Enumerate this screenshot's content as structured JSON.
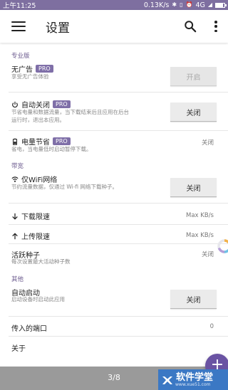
{
  "status_bar": {
    "time": "上午11:25",
    "speed": "0.13K/s",
    "network": "4G",
    "battery_level": 0.8,
    "icons": [
      "notification-icon",
      "bluetooth-icon",
      "vibrate-icon",
      "alarm-icon",
      "signal-icon",
      "battery-icon"
    ]
  },
  "appbar": {
    "title": "设置"
  },
  "sections": {
    "pro": "专业版",
    "torrents": "带宽",
    "other": "其他"
  },
  "rows": {
    "no_ads": {
      "title": "无广告",
      "badge": "PRO",
      "subtitle": "享受无广告体验",
      "button": "开启"
    },
    "auto_close": {
      "title": "自动关闭",
      "badge": "PRO",
      "subtitle_line1": "节省电量和数据流量，当下载结束后且应用在后台",
      "subtitle_line2": "运行时，退出本应用。",
      "button": "关闭"
    },
    "battery_saver": {
      "title": "电量节省",
      "badge": "PRO",
      "subtitle": "省电，当电量低时启动暂停下载。",
      "value": "关闭"
    },
    "wifi_only": {
      "title": "仅WiFi网络",
      "subtitle": "节约流量数据，仅通过 Wi-fi 网络下载种子。",
      "button": "关闭"
    },
    "download_limit": {
      "title": "下载限速",
      "value": "Max KB/s"
    },
    "upload_limit": {
      "title": "上传限速",
      "value": "Max KB/s"
    },
    "active_torrents": {
      "title": "活跃种子",
      "subtitle": "每次设置最大活动种子数",
      "value": "关闭"
    },
    "auto_start": {
      "title": "自动启动",
      "subtitle": "启动设备时启动此应用",
      "button": "关闭"
    },
    "incoming_port": {
      "title": "传入的端口",
      "value": "0"
    },
    "about": {
      "title": "关于"
    }
  },
  "pager": {
    "text": "3/8"
  },
  "fab": {
    "label": "+"
  },
  "watermark": {
    "name": "软件学堂",
    "url": "www.xue51.com"
  },
  "colors": {
    "accent": "#7f6fa8",
    "status_bar": "#7e6fa0",
    "bottom_bar": "#9a9a9a",
    "fab": "#6a53a3"
  }
}
